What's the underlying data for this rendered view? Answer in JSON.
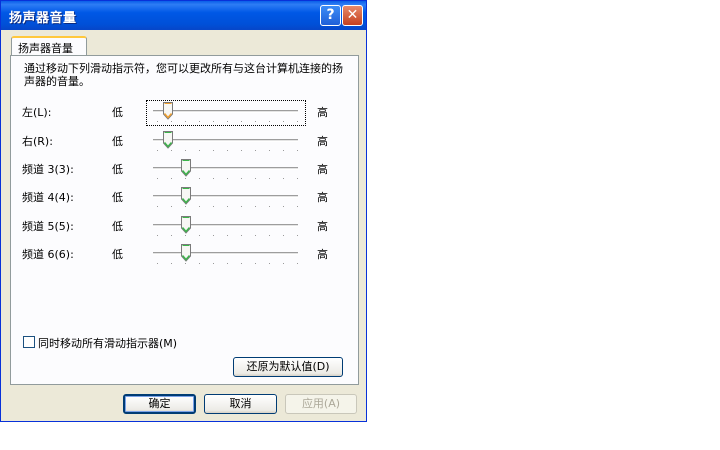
{
  "window": {
    "title": "扬声器音量",
    "help_label": "?",
    "close_label": "✕"
  },
  "tab": {
    "label": "扬声器音量"
  },
  "description": "通过移动下列滑动指示符，您可以更改所有与这台计算机连接的扬声器的音量。",
  "sliders": [
    {
      "label": "左(L):",
      "low": "低",
      "high": "高",
      "level": 0.1,
      "focused": true
    },
    {
      "label": "右(R):",
      "low": "低",
      "high": "高",
      "level": 0.1,
      "focused": false
    },
    {
      "label": "频道 3(3):",
      "low": "低",
      "high": "高",
      "level": 0.23,
      "focused": false
    },
    {
      "label": "频道 4(4):",
      "low": "低",
      "high": "高",
      "level": 0.23,
      "focused": false
    },
    {
      "label": "频道 5(5):",
      "low": "低",
      "high": "高",
      "level": 0.23,
      "focused": false
    },
    {
      "label": "频道 6(6):",
      "low": "低",
      "high": "高",
      "level": 0.23,
      "focused": false
    }
  ],
  "move_all_checkbox": {
    "label": "同时移动所有滑动指示器(M)",
    "checked": false
  },
  "restore_button": {
    "label": "还原为默认值(D)"
  },
  "footer": {
    "ok_label": "确定",
    "cancel_label": "取消",
    "apply_label": "应用(A)"
  },
  "colors": {
    "thumb_focused": "#f0a030",
    "thumb_normal": "#3cb44a"
  }
}
